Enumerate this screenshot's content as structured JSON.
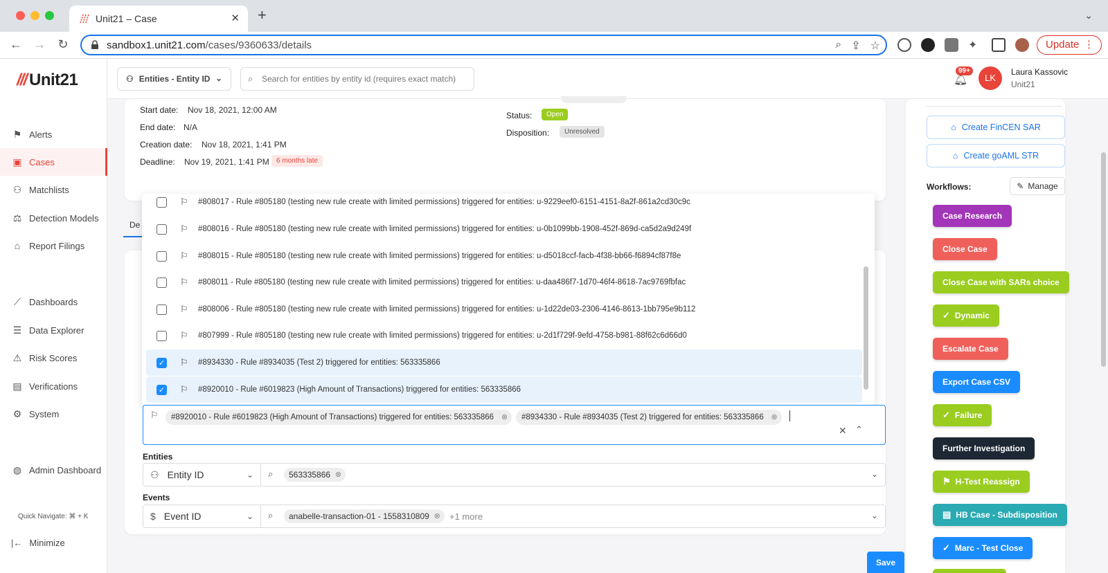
{
  "browser": {
    "tab_title": "Unit21 – Case",
    "tab_close": "✕",
    "tab_new": "+",
    "url_domain": "sandbox1.unit21.com",
    "url_path": "/cases/9360633/details",
    "update_label": "Update",
    "update_menu": "⋮"
  },
  "sidebar": {
    "brand": "Unit21",
    "items": [
      {
        "label": "Alerts"
      },
      {
        "label": "Cases"
      },
      {
        "label": "Matchlists"
      },
      {
        "label": "Detection Models"
      },
      {
        "label": "Report Filings"
      },
      {
        "label": "Dashboards"
      },
      {
        "label": "Data Explorer"
      },
      {
        "label": "Risk Scores"
      },
      {
        "label": "Verifications"
      },
      {
        "label": "System"
      },
      {
        "label": "Admin Dashboard"
      }
    ],
    "quick_navigate": "Quick Navigate: ⌘ + K",
    "minimize": "Minimize"
  },
  "topbar": {
    "entity_select": "Entities - Entity ID",
    "search_placeholder": "Search for entities by entity id (requires exact match)",
    "notifications": "99+",
    "avatar_initials": "LK",
    "user_name": "Laura Kassovic",
    "user_org": "Unit21"
  },
  "case_details": {
    "start_date_label": "Start date:",
    "start_date": "Nov 18, 2021, 12:00 AM",
    "end_date_label": "End date:",
    "end_date": "N/A",
    "creation_date_label": "Creation date:",
    "creation_date": "Nov 18, 2021, 1:41 PM",
    "deadline_label": "Deadline:",
    "deadline": "Nov 19, 2021, 1:41 PM",
    "deadline_badge": "6 months late",
    "status_label": "Status:",
    "status": "Open",
    "disposition_label": "Disposition:",
    "disposition": "Unresolved",
    "tab_partial": "De"
  },
  "dropdown": {
    "options": [
      {
        "label": "#808017 - Rule #805180 (testing new rule create with limited permissions) triggered for entities: u-9229eef0-6151-4151-8a2f-861a2cd30c9c",
        "checked": false
      },
      {
        "label": "#808016 - Rule #805180 (testing new rule create with limited permissions) triggered for entities: u-0b1099bb-1908-452f-869d-ca5d2a9d249f",
        "checked": false
      },
      {
        "label": "#808015 - Rule #805180 (testing new rule create with limited permissions) triggered for entities: u-d5018ccf-facb-4f38-bb66-f6894cf87f8e",
        "checked": false
      },
      {
        "label": "#808011 - Rule #805180 (testing new rule create with limited permissions) triggered for entities: u-daa486f7-1d70-46f4-8618-7ac9769fbfac",
        "checked": false
      },
      {
        "label": "#808006 - Rule #805180 (testing new rule create with limited permissions) triggered for entities: u-1d22de03-2306-4146-8613-1bb795e9b112",
        "checked": false
      },
      {
        "label": "#807999 - Rule #805180 (testing new rule create with limited permissions) triggered for entities: u-2d1f729f-9efd-4758-b981-88f62c6d66d0",
        "checked": false
      },
      {
        "label": "#8934330 - Rule #8934035 (Test 2) triggered for entities: 563335866",
        "checked": true
      },
      {
        "label": "#8920010 - Rule #6019823 (High Amount of Transactions) triggered for entities: 563335866",
        "checked": true
      }
    ],
    "selected_chips": [
      "#8920010 - Rule #6019823 (High Amount of Transactions) triggered for entities: 563335866",
      "#8934330 - Rule #8934035 (Test 2) triggered for entities: 563335866"
    ]
  },
  "entities": {
    "label": "Entities",
    "type": "Entity ID",
    "chip": "563335866"
  },
  "events": {
    "label": "Events",
    "type": "Event ID",
    "chip": "anabelle-transaction-01 - 1558310809",
    "more": "+1 more"
  },
  "actions": {
    "create_fincen": "Create FinCEN SAR",
    "create_goaml": "Create goAML STR",
    "workflows_label": "Workflows:",
    "manage": "Manage",
    "save": "Save"
  },
  "workflows": [
    {
      "label": "Case Research",
      "color": "#a335b8",
      "icon": ""
    },
    {
      "label": "Close Case",
      "color": "#f0605a",
      "icon": ""
    },
    {
      "label": "Close Case with SARs choice",
      "color": "#9acd1f",
      "icon": ""
    },
    {
      "label": "Dynamic",
      "color": "#9acd1f",
      "icon": "check-circle-icon"
    },
    {
      "label": "Escalate Case",
      "color": "#f0605a",
      "icon": ""
    },
    {
      "label": "Export Case CSV",
      "color": "#1a8cff",
      "icon": ""
    },
    {
      "label": "Failure",
      "color": "#9acd1f",
      "icon": "check-circle-icon"
    },
    {
      "label": "Further Investigation",
      "color": "#1e2835",
      "icon": ""
    },
    {
      "label": "H-Test Reassign",
      "color": "#9acd1f",
      "icon": "reassign-icon"
    },
    {
      "label": "HB Case - Subdisposition",
      "color": "#2aaab3",
      "icon": "document-icon"
    },
    {
      "label": "Marc - Test Close",
      "color": "#1a8cff",
      "icon": "check-circle-icon"
    }
  ]
}
